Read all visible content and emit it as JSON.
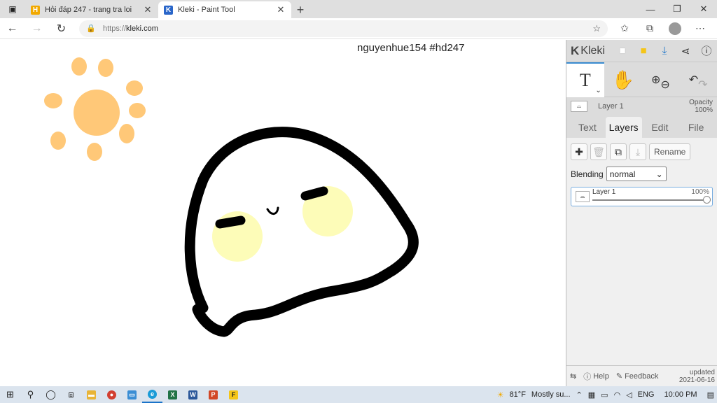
{
  "browser": {
    "tabs": [
      {
        "title": "Hỏi đáp 247 - trang tra loi",
        "favicon": "H",
        "favicon_color": "#f2a900",
        "active": false
      },
      {
        "title": "Kleki - Paint Tool",
        "favicon": "K",
        "favicon_color": "#2a66c9",
        "active": true
      }
    ],
    "url_protocol": "https://",
    "url_host": "kleki.com"
  },
  "canvas": {
    "watermark_text": "nguyenhue154 #hd247",
    "colors": {
      "sun": "#ffc878",
      "outline": "#000000",
      "cheek": "#fdfcb8"
    }
  },
  "panel": {
    "brand": "Kleki",
    "layer_strip": {
      "name": "Layer 1",
      "opacity_label": "Opacity",
      "opacity_value": "100%"
    },
    "tabs": [
      "Text",
      "Layers",
      "Edit",
      "File"
    ],
    "active_tab": "Layers",
    "rename_label": "Rename",
    "blending_label": "Blending",
    "blending_value": "normal",
    "layers": [
      {
        "name": "Layer 1",
        "opacity": "100%"
      }
    ],
    "footer": {
      "help": "Help",
      "feedback": "Feedback",
      "updated_label": "updated",
      "updated_date": "2021-06-16"
    }
  },
  "taskbar": {
    "weather_temp": "81°F",
    "weather_text": "Mostly su...",
    "language": "ENG",
    "time": "10:00 PM"
  }
}
